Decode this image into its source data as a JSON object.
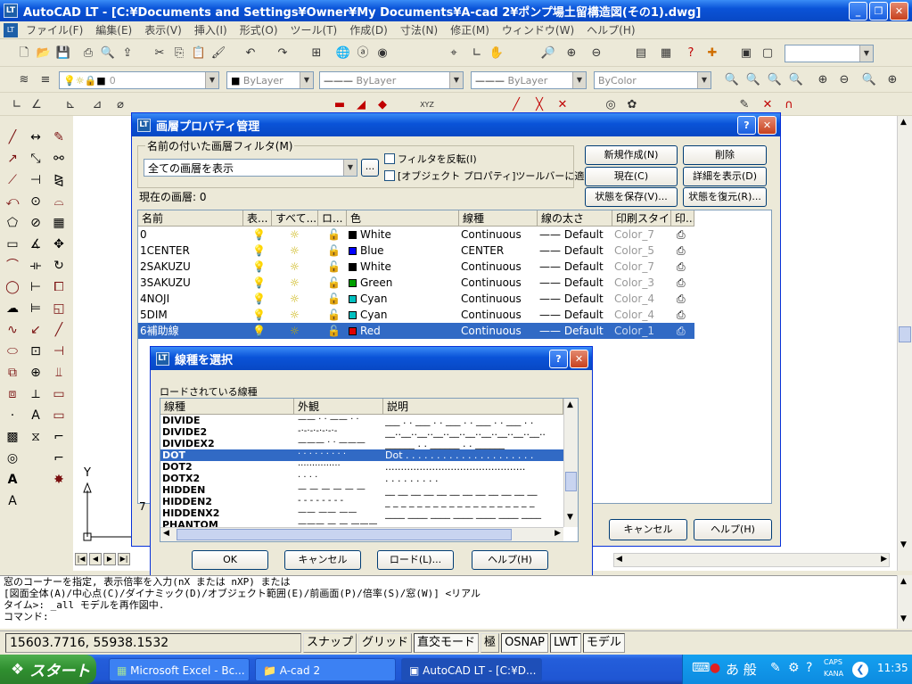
{
  "window": {
    "title": "AutoCAD LT - [C:¥Documents and Settings¥Owner¥My Documents¥A-cad 2¥ポンプ場土留構造図(その1).dwg]",
    "app_icon": "LT"
  },
  "menu": [
    "ファイル(F)",
    "編集(E)",
    "表示(V)",
    "挿入(I)",
    "形式(O)",
    "ツール(T)",
    "作成(D)",
    "寸法(N)",
    "修正(M)",
    "ウィンドウ(W)",
    "ヘルプ(H)"
  ],
  "properties_toolbar": {
    "layer_value": "0",
    "color_value": "ByLayer",
    "linetype_value": "ByLayer",
    "lineweight_value": "ByLayer",
    "plotstyle_value": "ByColor"
  },
  "layer_dialog": {
    "title": "画層プロパティ管理",
    "filter_group_label": "名前の付いた画層フィルタ(M)",
    "filter_value": "全ての画層を表示",
    "filter_more": "...",
    "invert_filter": "フィルタを反転(I)",
    "apply_to_toolbar": "[オブジェクト プロパティ]ツールバーに適用(T)",
    "buttons": {
      "new": "新規作成(N)",
      "delete": "削除",
      "current": "現在(C)",
      "details": "詳細を表示(D)",
      "save_state": "状態を保存(V)...",
      "restore_state": "状態を復元(R)..."
    },
    "current_layer_label": "現在の画層: 0",
    "columns": [
      "名前",
      "表...",
      "すべて...",
      "ロ...",
      "色",
      "線種",
      "線の太さ",
      "印刷スタイル",
      "印..."
    ],
    "rows": [
      {
        "name": "0",
        "color_name": "White",
        "color_hex": "#000000",
        "linetype": "Continuous",
        "lineweight": "Default",
        "plot_style": "Color_7"
      },
      {
        "name": "1CENTER",
        "color_name": "Blue",
        "color_hex": "#0000ff",
        "linetype": "CENTER",
        "lineweight": "Default",
        "plot_style": "Color_5"
      },
      {
        "name": "2SAKUZU",
        "color_name": "White",
        "color_hex": "#000000",
        "linetype": "Continuous",
        "lineweight": "Default",
        "plot_style": "Color_7"
      },
      {
        "name": "3SAKUZU",
        "color_name": "Green",
        "color_hex": "#00a000",
        "linetype": "Continuous",
        "lineweight": "Default",
        "plot_style": "Color_3"
      },
      {
        "name": "4NOJI",
        "color_name": "Cyan",
        "color_hex": "#00c0c0",
        "linetype": "Continuous",
        "lineweight": "Default",
        "plot_style": "Color_4"
      },
      {
        "name": "5DIM",
        "color_name": "Cyan",
        "color_hex": "#00c0c0",
        "linetype": "Continuous",
        "lineweight": "Default",
        "plot_style": "Color_4"
      },
      {
        "name": "6補助線",
        "color_name": "Red",
        "color_hex": "#e00000",
        "linetype": "Continuous",
        "lineweight": "Default",
        "plot_style": "Color_1"
      }
    ],
    "selected_row": 6,
    "status_count": "7",
    "bottom_buttons": {
      "cancel": "キャンセル",
      "help": "ヘルプ(H)"
    }
  },
  "linetype_dialog": {
    "title": "線種を選択",
    "group_label": "ロードされている線種",
    "columns": [
      "線種",
      "外観",
      "説明"
    ],
    "rows": [
      {
        "name": "DIVIDE",
        "desc": "___ . . ___ . . ___ . . ___ . . ___ . ."
      },
      {
        "name": "DIVIDE2",
        "desc": "__..__..__..__..__..__..__..__..__..__.."
      },
      {
        "name": "DIVIDEX2",
        "desc": "______  .  .  ______  .  .  ______"
      },
      {
        "name": "DOT",
        "desc": "Dot . . . . . . . . . . . . . . . . . . . . ."
      },
      {
        "name": "DOT2",
        "desc": "............................................."
      },
      {
        "name": "DOTX2",
        "desc": ".    .    .    .    .    .    .    .    ."
      },
      {
        "name": "HIDDEN",
        "desc": "__ __ __ __ __ __ __ __ __ __ __ __"
      },
      {
        "name": "HIDDEN2",
        "desc": "_ _ _ _ _ _ _ _ _ _ _ _ _ _ _ _ _ _ _"
      },
      {
        "name": "HIDDENX2",
        "desc": "____ ____ ____ ____ ____ ____ ____"
      },
      {
        "name": "PHANTOM",
        "desc": "______ __ __ ______ __ __ ______"
      }
    ],
    "selected_row": 3,
    "buttons": {
      "ok": "OK",
      "cancel": "キャンセル",
      "load": "ロード(L)...",
      "help": "ヘルプ(H)"
    }
  },
  "command_lines": [
    "窓のコーナーを指定, 表示倍率を入力(nX または nXP) または",
    "[図面全体(A)/中心点(C)/ダイナミック(D)/オブジェクト範囲(E)/前画面(P)/倍率(S)/窓(W)] <リアル",
    "タイム>:  _all モデルを再作図中.",
    "コマンド:"
  ],
  "status": {
    "coordinates": "15603.7716, 55938.1532",
    "toggles": [
      "スナップ",
      "グリッド",
      "直交モード",
      "極",
      "OSNAP",
      "LWT",
      "モデル"
    ]
  },
  "taskbar": {
    "start": "スタート",
    "tasks": [
      "Microsoft Excel - Bc...",
      "A-cad 2",
      "AutoCAD LT - [C:¥D..."
    ],
    "tray_caps": "CAPS",
    "tray_kana": "KANA",
    "ime": "あ 般",
    "clock": "11:35"
  }
}
